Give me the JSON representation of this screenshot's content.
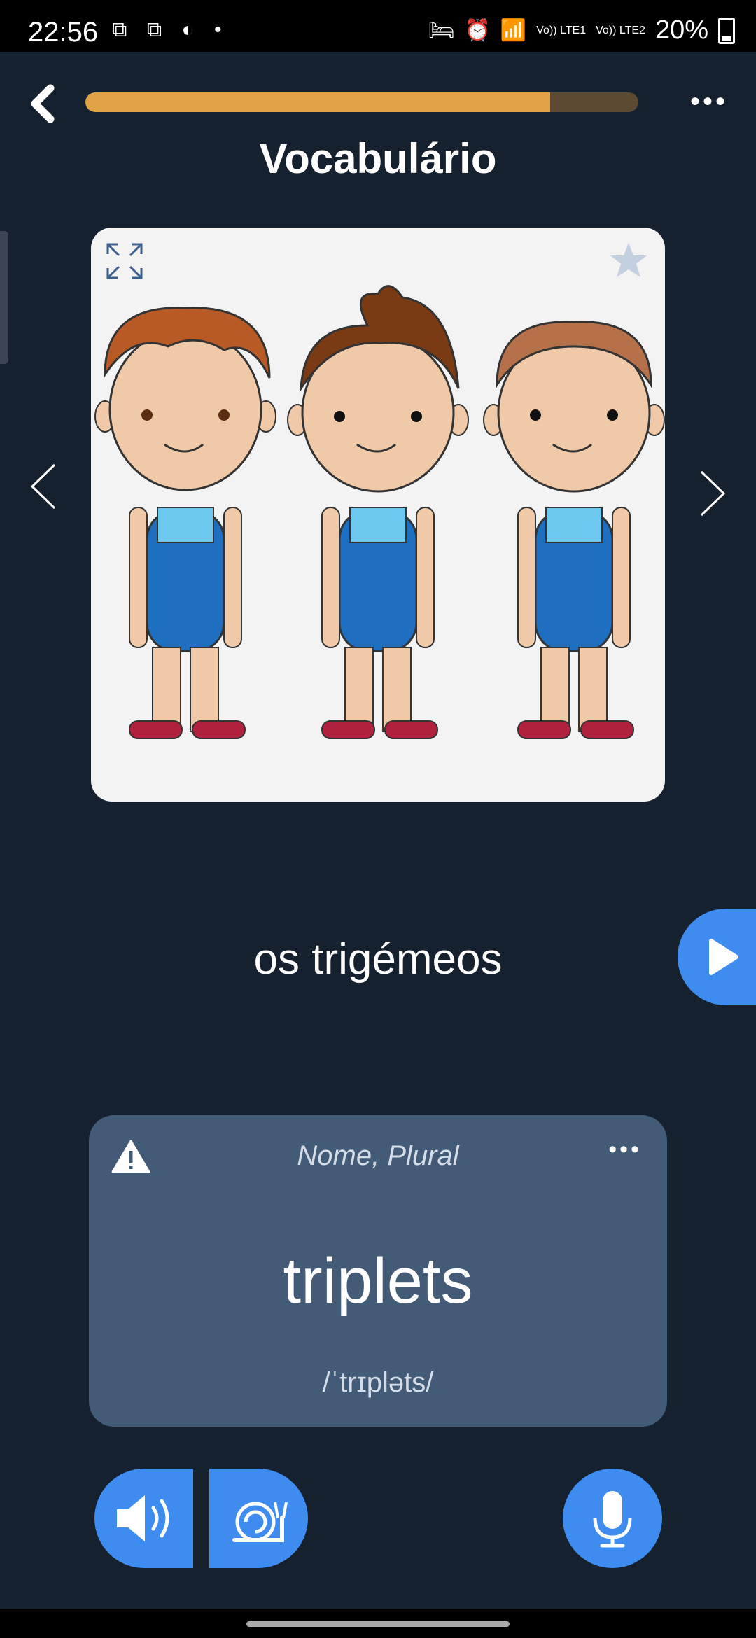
{
  "status_bar": {
    "time": "22:56",
    "left_icons": [
      "screen-record-icon",
      "screen-record-icon",
      "edge-icon",
      "dot"
    ],
    "right_icons": [
      "sleep-icon",
      "alarm-icon",
      "wifi-icon",
      "lte1-signal-icon",
      "lte2-signal-icon"
    ],
    "lte1": "Vo)) LTE1",
    "lte2": "Vo)) LTE2",
    "battery": "20%"
  },
  "header": {
    "progress": 0.84,
    "progress_color": "#e0a447",
    "track_color": "#5c4a33",
    "more_label": "•••"
  },
  "title": "Vocabulário",
  "image_card": {
    "description_icons": [
      "expand-icon",
      "star-icon"
    ]
  },
  "word": "os trigémeos",
  "translation_card": {
    "part_of_speech": "Nome, Plural",
    "translation": "triplets",
    "ipa": "/ˈtrɪpləts/",
    "more_label": "•••"
  },
  "colors": {
    "background": "#162130",
    "accent": "#3f8cf0",
    "card": "#435b77"
  }
}
